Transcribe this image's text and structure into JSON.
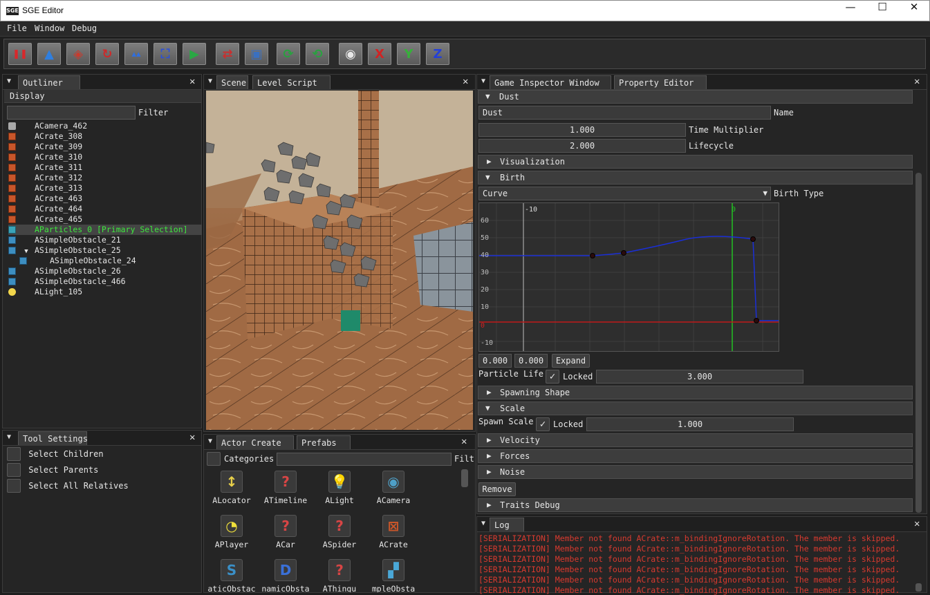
{
  "window": {
    "logo": "SGE",
    "title": "SGE Editor",
    "minimize": "—",
    "maximize": "☐",
    "close": "✕"
  },
  "menu": [
    "File",
    "Window",
    "Debug"
  ],
  "toolbar": {
    "buttons": [
      {
        "icon": "pause-icon",
        "color": "#d8282b",
        "glyph": "❚❚"
      },
      {
        "icon": "move-icon",
        "color": "#2f7fe0",
        "glyph": "▲"
      },
      {
        "icon": "rotate-icon",
        "color": "#c83b2e",
        "glyph": "◈"
      },
      {
        "icon": "refresh-icon",
        "color": "#cc2a2a",
        "glyph": "↻"
      },
      {
        "icon": "scale-icon",
        "color": "#2f6fe0",
        "glyph": "▴▴"
      },
      {
        "icon": "fit-icon",
        "color": "#2b4fd8",
        "glyph": "⛶"
      },
      {
        "icon": "play-add-icon",
        "color": "#2aa844",
        "glyph": "▶"
      },
      {
        "icon": "swap-icon",
        "color": "#c83030",
        "glyph": "⇄"
      },
      {
        "icon": "window-icon",
        "color": "#3a70c0",
        "glyph": "▣"
      },
      {
        "icon": "reload-green-icon",
        "color": "#2aa040",
        "glyph": "⟳"
      },
      {
        "icon": "reload-globe-icon",
        "color": "#2aa040",
        "glyph": "⟲"
      },
      {
        "icon": "camera-icon",
        "color": "#e8e8e8",
        "glyph": "◉"
      },
      {
        "icon": "axis-x-icon",
        "color": "#d02424",
        "glyph": "X"
      },
      {
        "icon": "axis-y-icon",
        "color": "#36b03a",
        "glyph": "Y"
      },
      {
        "icon": "axis-z-icon",
        "color": "#2440d8",
        "glyph": "Z"
      }
    ]
  },
  "outliner": {
    "tab": "Outliner",
    "display_label": "Display",
    "filter_label": "Filter",
    "filter_value": "",
    "items": [
      {
        "name": "ACamera_462",
        "icon": "camera",
        "indent": 0
      },
      {
        "name": "ACrate_308",
        "icon": "crate",
        "indent": 0
      },
      {
        "name": "ACrate_309",
        "icon": "crate",
        "indent": 0
      },
      {
        "name": "ACrate_310",
        "icon": "crate",
        "indent": 0
      },
      {
        "name": "ACrate_311",
        "icon": "crate",
        "indent": 0
      },
      {
        "name": "ACrate_312",
        "icon": "crate",
        "indent": 0
      },
      {
        "name": "ACrate_313",
        "icon": "crate",
        "indent": 0
      },
      {
        "name": "ACrate_463",
        "icon": "crate",
        "indent": 0
      },
      {
        "name": "ACrate_464",
        "icon": "crate",
        "indent": 0
      },
      {
        "name": "ACrate_465",
        "icon": "crate",
        "indent": 0
      },
      {
        "name": "AParticles_0 [Primary Selection]",
        "icon": "particles",
        "indent": 0,
        "selected": true
      },
      {
        "name": "ASimpleObstacle_21",
        "icon": "obstacle",
        "indent": 0
      },
      {
        "name": "ASimpleObstacle_25",
        "icon": "obstacle",
        "indent": 0,
        "expanded": true
      },
      {
        "name": "ASimpleObstacle_24",
        "icon": "obstacle",
        "indent": 1
      },
      {
        "name": "ASimpleObstacle_26",
        "icon": "obstacle",
        "indent": 0
      },
      {
        "name": "ASimpleObstacle_466",
        "icon": "obstacle",
        "indent": 0
      },
      {
        "name": "ALight_105",
        "icon": "light",
        "indent": 0
      }
    ],
    "selected_color": "#3ee83e"
  },
  "tool_settings": {
    "tab": "Tool Settings",
    "options": [
      "Select Children",
      "Select Parents",
      "Select All Relatives"
    ]
  },
  "scene": {
    "tabs": [
      "Scene",
      "Level Script"
    ]
  },
  "actor_create": {
    "tabs": [
      "Actor Create",
      "Prefabs"
    ],
    "categories_label": "Categories",
    "filter_label": "Filt",
    "actors": [
      {
        "name": "ALocator",
        "icon": "locator-icon",
        "color": "#e8d04a",
        "glyph": "↕"
      },
      {
        "name": "ATimeline",
        "icon": "unknown-icon",
        "color": "#d84545",
        "glyph": "?"
      },
      {
        "name": "ALight",
        "icon": "lightbulb-icon",
        "color": "#f0d84a",
        "glyph": "💡"
      },
      {
        "name": "ACamera",
        "icon": "camera-icon",
        "color": "#4ea0c8",
        "glyph": "◉"
      },
      {
        "name": "APlayer",
        "icon": "pacman-icon",
        "color": "#f0e03a",
        "glyph": "◔"
      },
      {
        "name": "ACar",
        "icon": "unknown-icon",
        "color": "#d84545",
        "glyph": "?"
      },
      {
        "name": "ASpider",
        "icon": "unknown-icon",
        "color": "#d84545",
        "glyph": "?"
      },
      {
        "name": "ACrate",
        "icon": "crate-icon",
        "color": "#c8562a",
        "glyph": "⊠"
      },
      {
        "name": "aticObstac",
        "icon": "static-obstacle-icon",
        "color": "#3a90c8",
        "glyph": "S"
      },
      {
        "name": "namicObsta",
        "icon": "dynamic-obstacle-icon",
        "color": "#3a70d8",
        "glyph": "D"
      },
      {
        "name": "AThingu",
        "icon": "unknown-icon",
        "color": "#d84545",
        "glyph": "?"
      },
      {
        "name": "mpleObsta",
        "icon": "simple-obstacle-icon",
        "color": "#4aa8d8",
        "glyph": "▞"
      }
    ]
  },
  "inspector": {
    "tabs": [
      "Game Inspector Window",
      "Property Editor"
    ],
    "dust_header": "Dust",
    "name_value": "Dust",
    "name_label": "Name",
    "time_multiplier": "1.000",
    "time_multiplier_label": "Time Multiplier",
    "lifecycle": "2.000",
    "lifecycle_label": "Lifecycle",
    "visualization": "Visualization",
    "birth": "Birth",
    "birth_type_value": "Curve",
    "birth_type_label": "Birth Type",
    "curve": {
      "y_ticks": [
        "60",
        "50",
        "40",
        "30",
        "20",
        "10",
        "0",
        "-10"
      ],
      "x_tick_left": "-10",
      "x_tick_zero": "0"
    },
    "curve_val1": "0.000",
    "curve_val2": "0.000",
    "expand_label": "Expand",
    "particle_life_label": "Particle Life",
    "locked_label": "Locked",
    "particle_life_value": "3.000",
    "spawning_shape": "Spawning Shape",
    "scale": "Scale",
    "spawn_scale_label": "Spawn Scale",
    "spawn_scale_value": "1.000",
    "velocity": "Velocity",
    "forces": "Forces",
    "noise": "Noise",
    "remove_label": "Remove",
    "traits_debug": "Traits Debug"
  },
  "log": {
    "tab": "Log",
    "lines": [
      "[SERIALIZATION] Member not found ACrate::m_bindingIgnoreRotation. The member is skipped.",
      "[SERIALIZATION] Member not found ACrate::m_bindingIgnoreRotation. The member is skipped.",
      "[SERIALIZATION] Member not found ACrate::m_bindingIgnoreRotation. The member is skipped.",
      "[SERIALIZATION] Member not found ACrate::m_bindingIgnoreRotation. The member is skipped.",
      "[SERIALIZATION] Member not found ACrate::m_bindingIgnoreRotation. The member is skipped.",
      "[SERIALIZATION] Member not found ACrate::m_bindingIgnoreRotation. The member is skipped."
    ]
  }
}
